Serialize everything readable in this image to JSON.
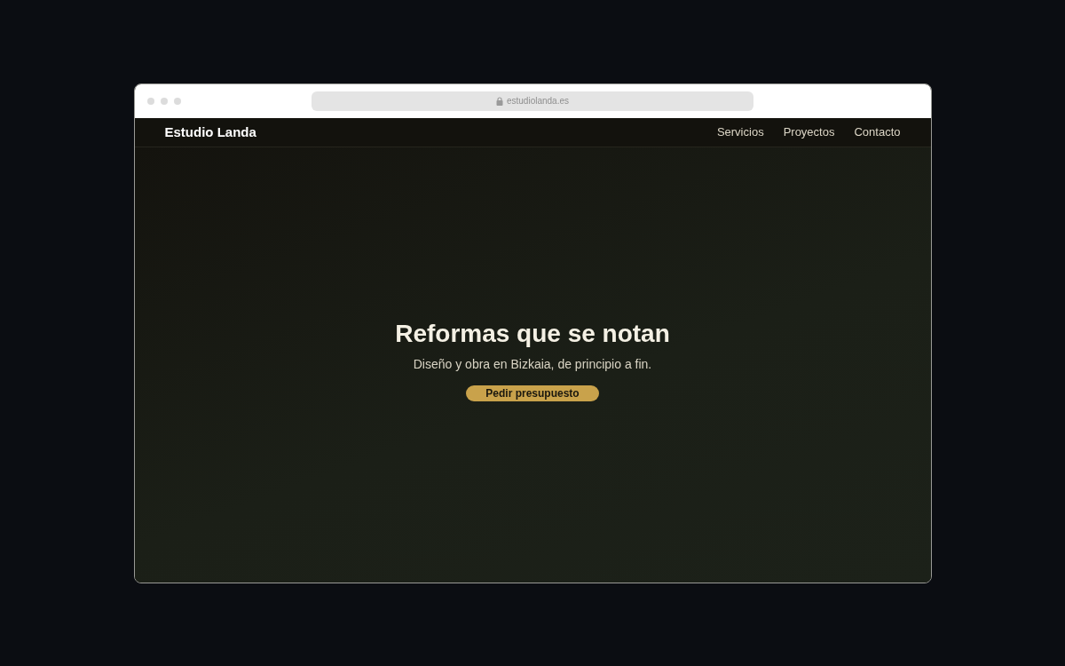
{
  "browser": {
    "url": "estudiolanda.es"
  },
  "site": {
    "brand": "Estudio Landa",
    "nav": [
      "Servicios",
      "Proyectos",
      "Contacto"
    ]
  },
  "hero": {
    "title": "Reformas que se notan",
    "subtitle": "Diseño y obra en Bizkaia, de principio a fin.",
    "cta": "Pedir presupuesto"
  }
}
